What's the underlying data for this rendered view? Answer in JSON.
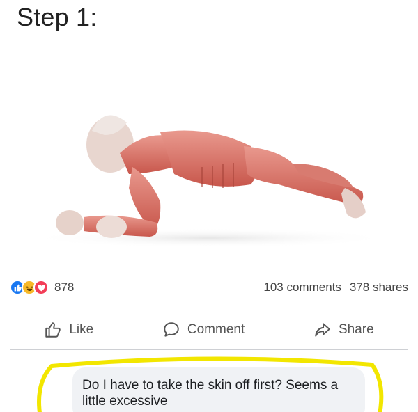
{
  "post": {
    "text": "Step 1:"
  },
  "image": {
    "subject": "plank-anatomy-figure"
  },
  "reactions": {
    "icons": [
      "like-icon",
      "haha-icon",
      "love-icon"
    ],
    "count": "878",
    "comments": "103 comments",
    "shares": "378 shares"
  },
  "actions": {
    "like": "Like",
    "comment": "Comment",
    "share": "Share"
  },
  "comment": {
    "text": "Do I have to take the skin off first? Seems a little excessive"
  },
  "colors": {
    "like_blue": "#1877f2",
    "haha_yellow": "#f7b928",
    "love_red": "#f33e58",
    "highlight_yellow": "#f2e600",
    "comment_bg": "#f0f2f5"
  }
}
